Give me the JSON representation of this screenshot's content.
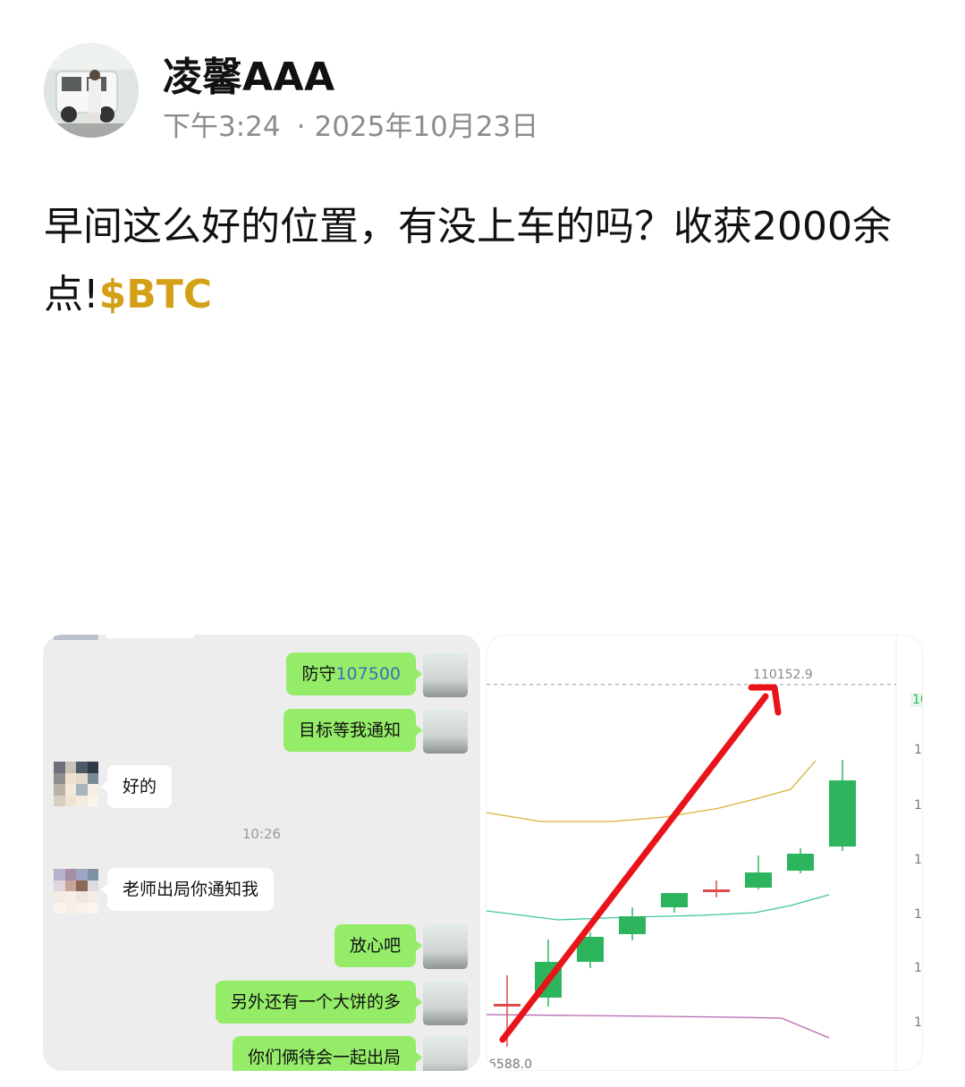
{
  "post": {
    "author": "凌馨AAA",
    "time": "下午3:24",
    "date": "2025年10月23日",
    "text": "早间这么好的位置，有没上车的吗？收获2000余点!",
    "tag": "$BTC"
  },
  "chat": {
    "messages": [
      {
        "side": "right",
        "text": "防守",
        "num": "107500"
      },
      {
        "side": "right",
        "text": "目标等我通知"
      },
      {
        "side": "left",
        "text": "好的"
      },
      {
        "side": "left",
        "text": "老师出局你通知我"
      },
      {
        "side": "right",
        "text": "放心吧"
      },
      {
        "side": "right",
        "text": "另外还有一个大饼的多"
      },
      {
        "side": "right",
        "text": "你们俩待会一起出局"
      }
    ],
    "timestamp": "10:26"
  },
  "chart_data": {
    "type": "candlestick",
    "peak_label": "110152.9",
    "bottom_label": "6588.0",
    "right_axis_partial": [
      "10",
      "1(",
      "1(",
      "1(",
      "1(",
      "1(",
      "1("
    ],
    "candles": [
      {
        "o": 106580,
        "h": 106900,
        "l": 106100,
        "c": 106580,
        "color": "red"
      },
      {
        "o": 106650,
        "h": 107300,
        "l": 106550,
        "c": 107050,
        "color": "green"
      },
      {
        "o": 107050,
        "h": 107380,
        "l": 106980,
        "c": 107330,
        "color": "green"
      },
      {
        "o": 107360,
        "h": 107660,
        "l": 107290,
        "c": 107560,
        "color": "green"
      },
      {
        "o": 107660,
        "h": 107820,
        "l": 107600,
        "c": 107820,
        "color": "green"
      },
      {
        "o": 107860,
        "h": 107960,
        "l": 107770,
        "c": 107850,
        "color": "red"
      },
      {
        "o": 107880,
        "h": 108240,
        "l": 107860,
        "c": 108050,
        "color": "green"
      },
      {
        "o": 108070,
        "h": 108320,
        "l": 108040,
        "c": 108260,
        "color": "green"
      },
      {
        "o": 108340,
        "h": 109310,
        "l": 108290,
        "c": 109080,
        "color": "green"
      }
    ],
    "ylim": [
      106000,
      110400
    ],
    "reference_line": 110152.9,
    "colors": {
      "up": "#2db55d",
      "down": "#e04a4a",
      "upper_band": "#d9b233",
      "mid_band": "#3ec7a0",
      "lower_band": "#b764b0",
      "arrow": "#e8141a"
    }
  }
}
